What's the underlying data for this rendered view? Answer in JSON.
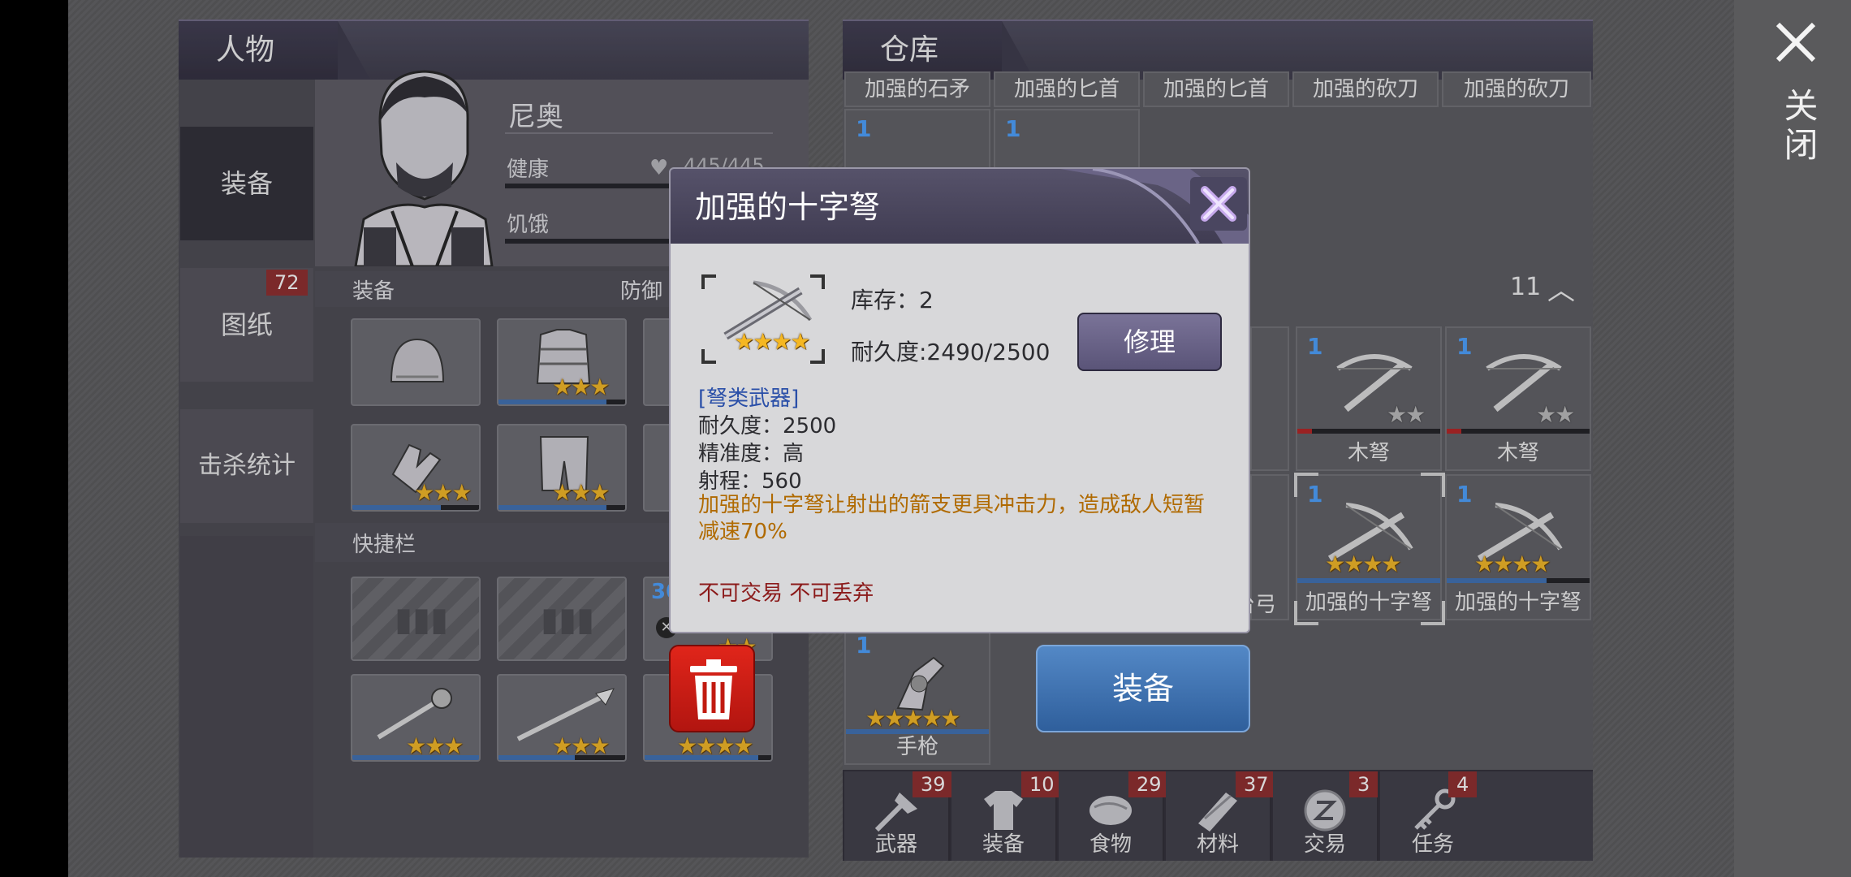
{
  "close": {
    "label": "关闭"
  },
  "character": {
    "header": "人物",
    "tabs": [
      {
        "label": "装备"
      },
      {
        "label": "图纸",
        "badge": "72"
      },
      {
        "label": "击杀统计"
      }
    ],
    "name": "尼奥",
    "health_label": "健康",
    "health_value": "445/445",
    "hunger_label": "饥饿",
    "equip_section": "装备",
    "defense_label": "防御",
    "quickbar_section": "快捷栏",
    "quick_count": "30"
  },
  "storage": {
    "header": "仓库",
    "top_row_names": [
      "加强的石矛",
      "加强的匕首",
      "加强的匕首",
      "加强的砍刀",
      "加强的砍刀"
    ],
    "top_row_counts": [
      "1",
      "1"
    ],
    "sort_count": "11",
    "items": [
      {
        "count": "1",
        "name": "木弩",
        "stars_filled": 0,
        "stars_total": 2
      },
      {
        "count": "1",
        "name": "木弩",
        "stars_filled": 0,
        "stars_total": 2
      },
      {
        "count": "1",
        "name": "加强的十字弩",
        "stars_filled": 4,
        "stars_total": 4
      },
      {
        "count": "1",
        "name": "加强的十字弩",
        "stars_filled": 4,
        "stars_total": 4
      },
      {
        "count": "1",
        "name": "手枪",
        "stars_filled": 5,
        "stars_total": 5
      }
    ],
    "partial_name": "台弓",
    "categories": [
      {
        "label": "武器",
        "badge": "39",
        "icon": "axe-icon"
      },
      {
        "label": "装备",
        "badge": "10",
        "icon": "shirt-icon"
      },
      {
        "label": "食物",
        "badge": "29",
        "icon": "meat-icon"
      },
      {
        "label": "材料",
        "badge": "37",
        "icon": "wood-icon"
      },
      {
        "label": "交易",
        "badge": "3",
        "icon": "coin-icon"
      },
      {
        "label": "任务",
        "badge": "4",
        "icon": "key-icon"
      }
    ]
  },
  "dialog": {
    "title": "加强的十字弩",
    "stock": "库存：2",
    "durability": "耐久度:2490/2500",
    "repair_label": "修理",
    "category": "[弩类武器]",
    "stat_durability": "耐久度：2500",
    "stat_accuracy": "精准度：高",
    "stat_range": "射程：560",
    "description": "加强的十字弩让射出的箭支更具冲击力，造成敌人短暂减速70%",
    "restriction": "不可交易 不可丢弃",
    "stars": 4
  },
  "equip_button": {
    "label": "装备"
  },
  "colors": {
    "accent_blue": "#3e6fb3",
    "star": "#f5b722",
    "danger": "#8b1a1a",
    "description": "#b06a00"
  }
}
